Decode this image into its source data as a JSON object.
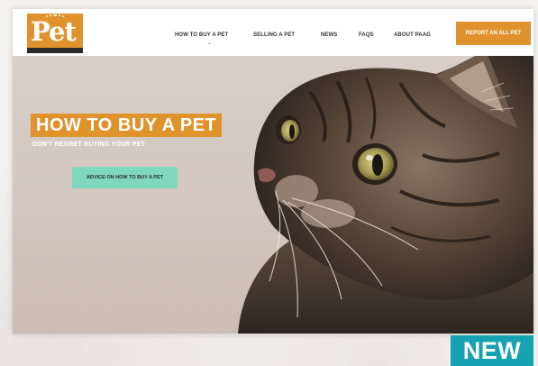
{
  "site": {
    "logo_text": "Pet",
    "nav": [
      {
        "label": "HOW TO BUY A PET"
      },
      {
        "label": "SELLING A PET"
      },
      {
        "label": "NEWS"
      },
      {
        "label": "FAQS"
      },
      {
        "label": "ABOUT PAAG"
      }
    ],
    "cta_label": "REPORT AN ALL PET",
    "active_caret": "⌄"
  },
  "hero": {
    "title": "HOW TO BUY A PET",
    "subtitle": "DON'T REGRET BUYING YOUR PET",
    "button_label": "ADVICE ON HOW TO BUY A PET",
    "image": "cat-photo"
  },
  "badge": {
    "label": "NEW"
  },
  "colors": {
    "brand_orange": "#e0932c",
    "cta_mint": "#7fd8bd",
    "badge_teal": "#17a2b1"
  }
}
